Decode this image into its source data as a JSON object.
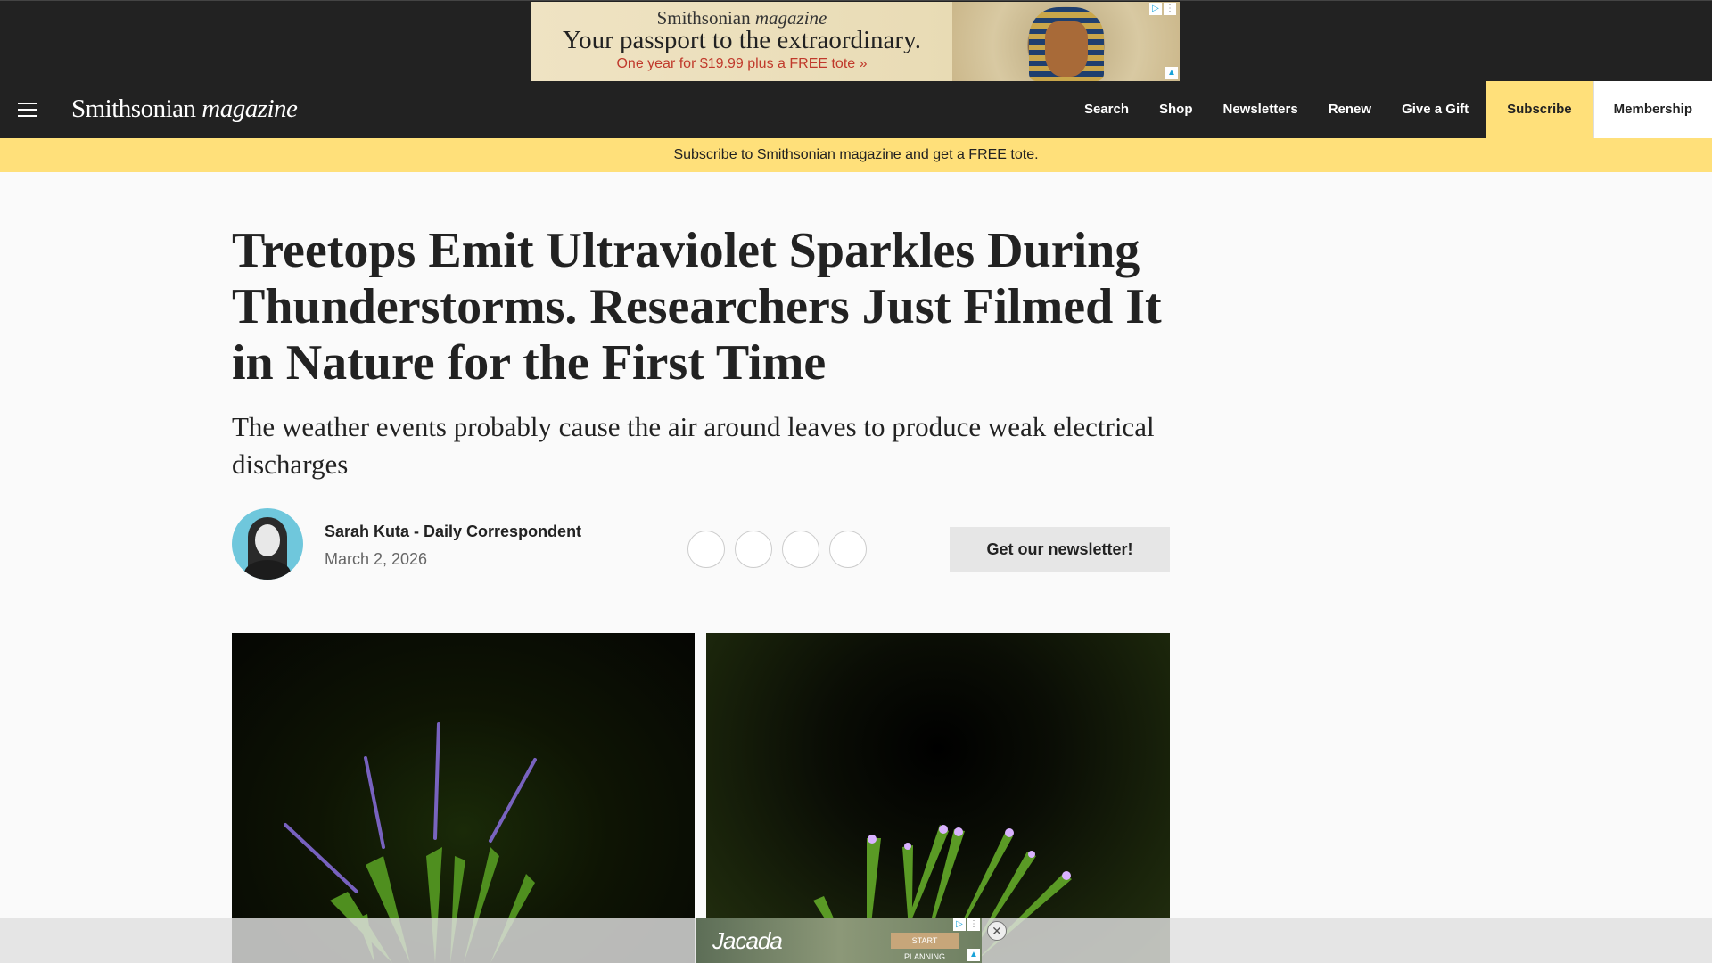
{
  "ad_top": {
    "brand_main": "Smithsonian",
    "brand_italic": "magazine",
    "headline": "Your passport to the extraordinary.",
    "offer": "One year for $19.99 plus a FREE tote »"
  },
  "nav": {
    "logo_main": "Smithsonian",
    "logo_italic": "magazine",
    "links": [
      "Search",
      "Shop",
      "Newsletters",
      "Renew",
      "Give a Gift",
      "Subscribe",
      "Membership"
    ]
  },
  "promo": "Subscribe to Smithsonian magazine and get a FREE tote.",
  "article": {
    "title": "Treetops Emit Ultraviolet Sparkles During Thunderstorms. Researchers Just Filmed It in Nature for the First Time",
    "dek": "The weather events probably cause the air around leaves to produce weak electrical discharges",
    "author": "Sarah Kuta - Daily Correspondent",
    "date": "March 2, 2026",
    "newsletter_button": "Get our newsletter!"
  },
  "ad_bottom": {
    "logo": "Jacada",
    "cta": "START PLANNING",
    "close": "✕"
  },
  "colors": {
    "nav_bg": "#222222",
    "accent_yellow": "#ffe07a"
  }
}
